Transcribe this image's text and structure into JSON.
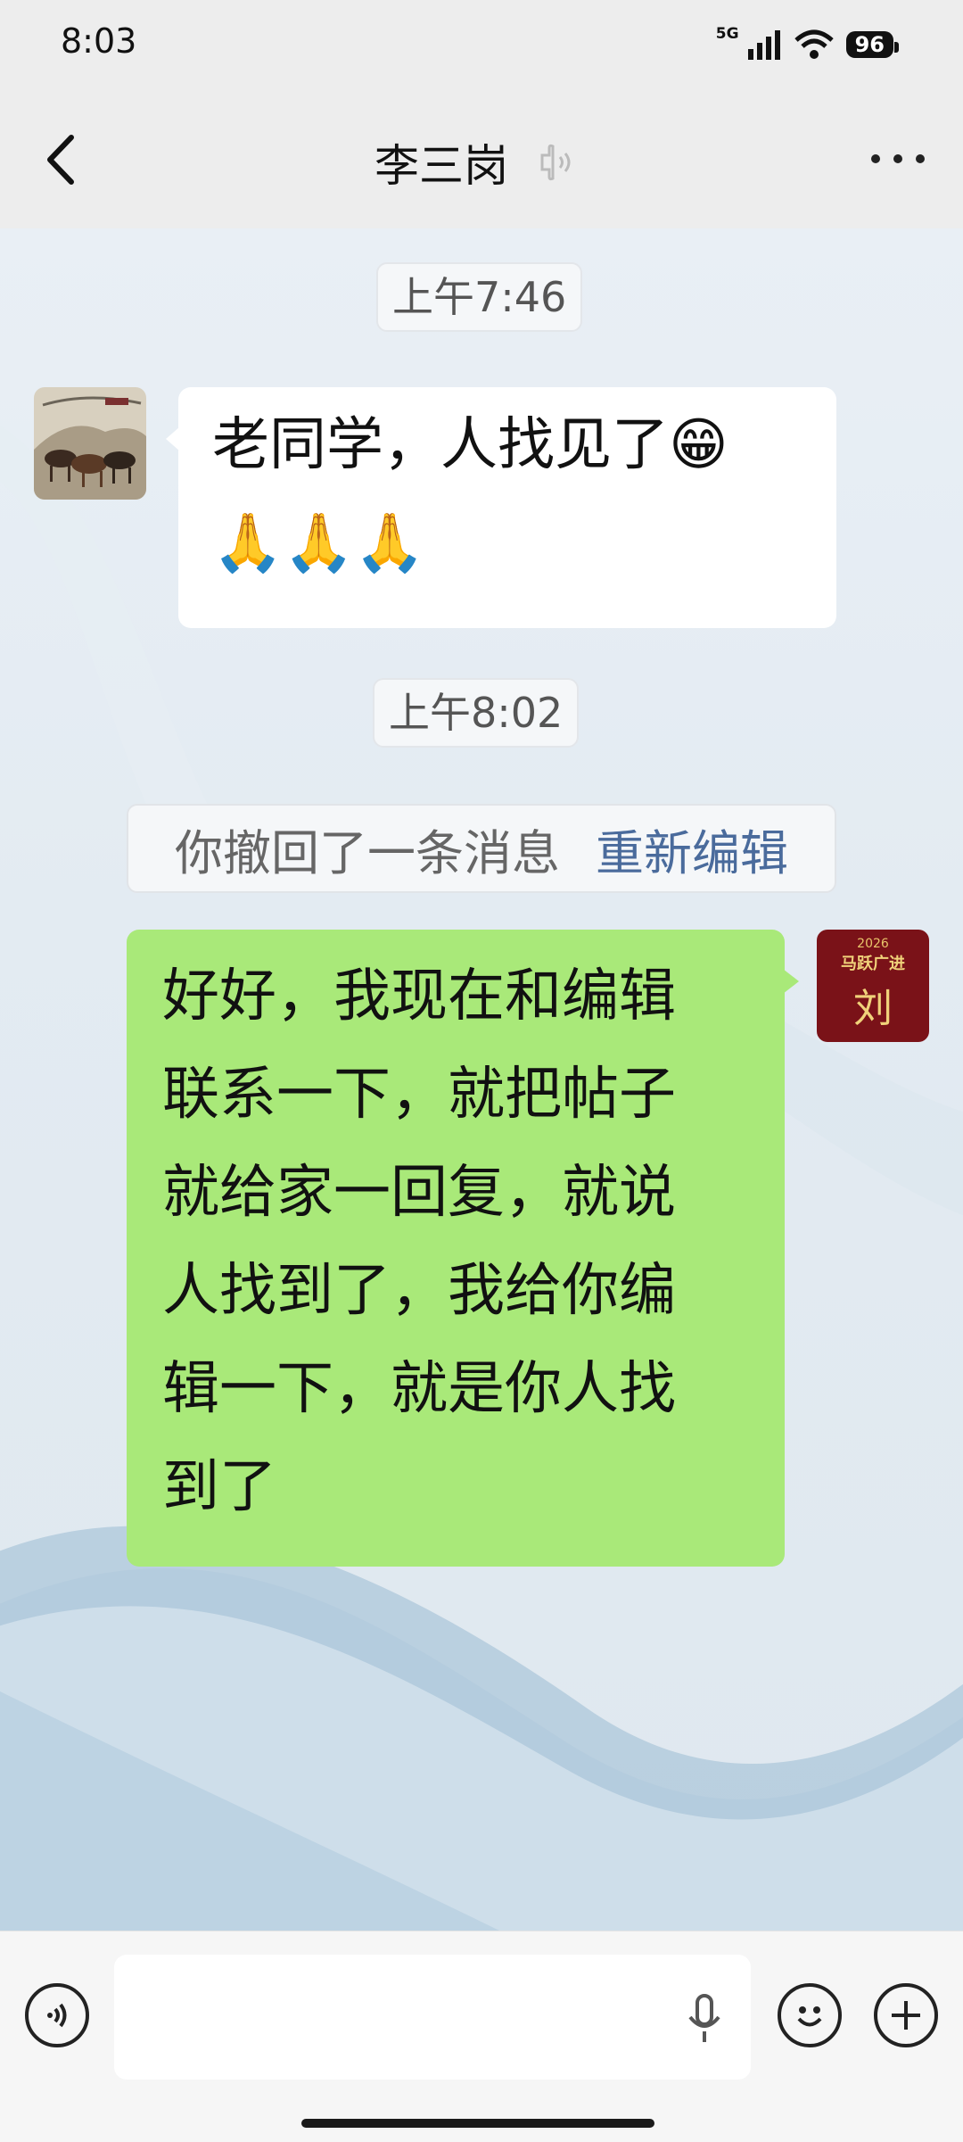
{
  "status_bar": {
    "time": "8:03",
    "network": "5G",
    "battery": "96"
  },
  "header": {
    "back_icon": "chevron-left-icon",
    "title": "李三岗",
    "mute_icon": "speaker-icon",
    "more_icon": "more-dots-icon"
  },
  "messages": {
    "time_1": "上午7:46",
    "incoming_text_line1": "老同学，人找见了😁",
    "incoming_text_line2": "🙏🙏🙏",
    "time_2": "上午8:02",
    "recall_notice": "你撤回了一条消息",
    "recall_action": "重新编辑",
    "outgoing_lines": [
      "好好，我现在和编辑",
      "联系一下，就把帖子",
      "就给家一回复，就说",
      "人找到了，我给你编",
      "辑一下，就是你人找",
      "到了"
    ]
  },
  "avatar_right": {
    "line1": "2026",
    "line2": "马跃广进",
    "line3": "刘"
  },
  "input_bar": {
    "voice_icon": "voice-icon",
    "mic_icon": "mic-icon",
    "emoji_icon": "emoji-icon",
    "plus_icon": "plus-icon"
  },
  "colors": {
    "incoming_bubble": "#ffffff",
    "outgoing_bubble": "#a9e979",
    "link": "#4a6b9c"
  }
}
